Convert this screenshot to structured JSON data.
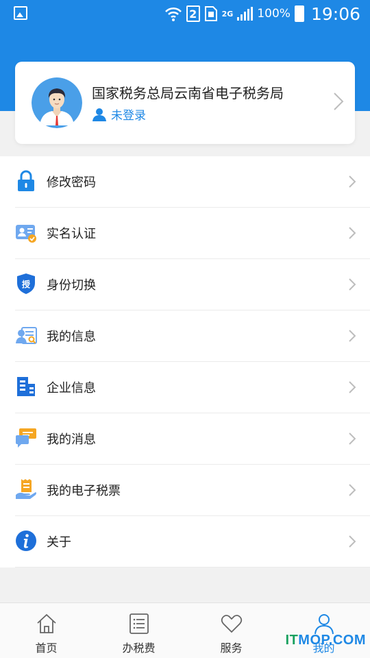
{
  "status_bar": {
    "sim_slot": "2",
    "network": "2G",
    "battery": "100%",
    "time": "19:06"
  },
  "profile": {
    "org_name": "国家税务总局云南省电子税务局",
    "login_status": "未登录"
  },
  "menu": {
    "items": [
      {
        "label": "修改密码",
        "icon": "lock-icon"
      },
      {
        "label": "实名认证",
        "icon": "id-card-verified-icon"
      },
      {
        "label": "身份切换",
        "icon": "shield-auth-icon"
      },
      {
        "label": "我的信息",
        "icon": "profile-card-search-icon"
      },
      {
        "label": "企业信息",
        "icon": "building-icon"
      },
      {
        "label": "我的消息",
        "icon": "chat-bubbles-icon"
      },
      {
        "label": "我的电子税票",
        "icon": "receipt-hand-icon"
      },
      {
        "label": "关于",
        "icon": "info-icon"
      }
    ]
  },
  "tab_bar": {
    "tabs": [
      {
        "label": "首页",
        "icon": "home-icon"
      },
      {
        "label": "办税费",
        "icon": "list-icon"
      },
      {
        "label": "服务",
        "icon": "heart-icon"
      },
      {
        "label": "我的",
        "icon": "person-icon",
        "active": true
      }
    ]
  },
  "watermark": {
    "prefix": "IT",
    "suffix": "MOP.COM"
  },
  "colors": {
    "accent": "#1e88e5",
    "background": "#f1f1f1"
  }
}
